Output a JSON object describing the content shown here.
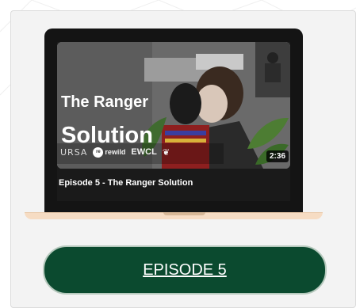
{
  "video": {
    "thumbnail_title_line1": "The Ranger",
    "thumbnail_title_line2": "Solution",
    "duration": "2:36",
    "caption": "Episode 5 - The Ranger Solution",
    "logos": [
      "URSA",
      "rewild",
      "EWCL"
    ]
  },
  "button": {
    "label": "EPISODE 5"
  },
  "colors": {
    "button_bg": "#0b4a2f",
    "card_bg": "#f3f3f3",
    "laptop_bezel": "#141414",
    "laptop_base": "#f6dcc3"
  },
  "icons": {
    "rewild_logo": "rewild-logo-icon",
    "emblem": "emblem-icon"
  }
}
